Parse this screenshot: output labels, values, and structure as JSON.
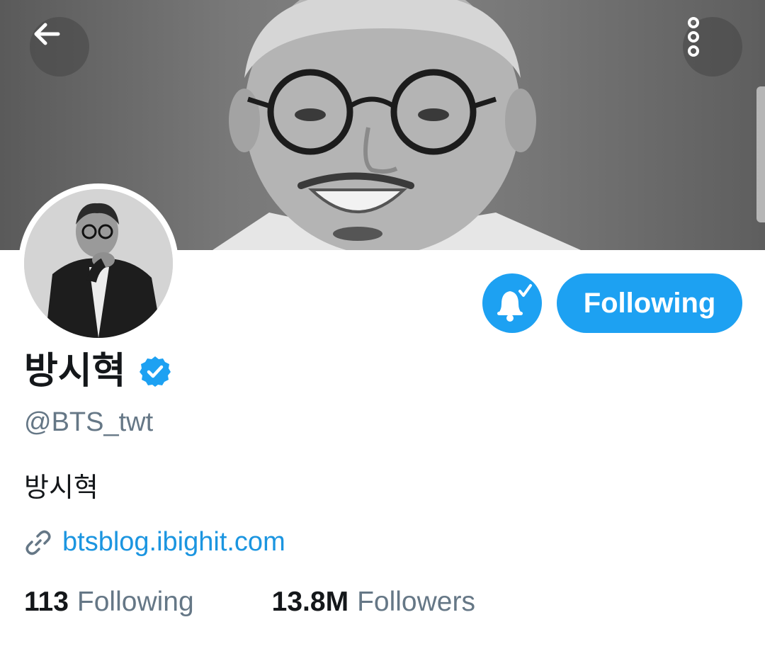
{
  "header": {
    "back_icon": "arrow-left-icon",
    "more_icon": "more-vertical-icon"
  },
  "profile": {
    "display_name": "방시혁",
    "verified": true,
    "handle": "@BTS_twt",
    "bio": "방시혁",
    "link": "btsblog.ibighit.com",
    "link_icon": "link-icon"
  },
  "actions": {
    "notifications_icon": "bell-check-icon",
    "follow_label": "Following"
  },
  "stats": {
    "following_count": "113",
    "following_label": "Following",
    "followers_count": "13.8M",
    "followers_label": "Followers"
  },
  "colors": {
    "accent": "#1da1f2",
    "link": "#1b95e0",
    "secondary_text": "#657786",
    "primary_text": "#14171a"
  }
}
